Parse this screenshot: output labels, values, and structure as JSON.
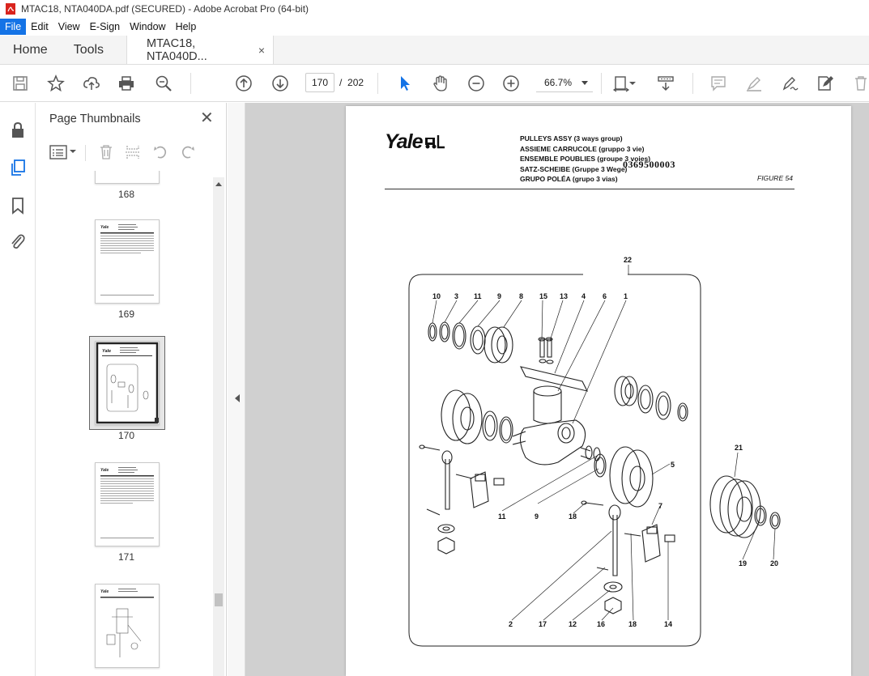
{
  "window": {
    "title": "MTAC18, NTA040DA.pdf (SECURED) - Adobe Acrobat Pro (64-bit)"
  },
  "menu": [
    "File",
    "Edit",
    "View",
    "E-Sign",
    "Window",
    "Help"
  ],
  "tabs": {
    "home": "Home",
    "tools": "Tools",
    "document": "MTAC18, NTA040D...",
    "close": "×"
  },
  "toolbar": {
    "current_page": "170",
    "page_sep": "/",
    "total_pages": "202",
    "zoom": "66.7%"
  },
  "thumbnails": {
    "title": "Page Thumbnails",
    "close": "✕",
    "pages": [
      "168",
      "169",
      "170",
      "171"
    ],
    "selected": "170"
  },
  "page": {
    "logo": "Yale",
    "header_lines": [
      "PULLEYS ASSY (3 ways group)",
      "ASSIEME CARRUCOLE (gruppo 3 vie)",
      "ENSEMBLE POUBLIES (groupe 3 voies)",
      "SATZ-SCHEIBE (Gruppe 3 Wege)",
      "GRUPO POLÉA (grupo 3 vias)"
    ],
    "part_number": "0369500003",
    "figure": "FIGURE 54",
    "callouts": [
      "22",
      "10",
      "3",
      "11",
      "9",
      "8",
      "15",
      "13",
      "4",
      "6",
      "1",
      "5",
      "21",
      "11",
      "9",
      "18",
      "7",
      "19",
      "20",
      "2",
      "17",
      "12",
      "16",
      "18",
      "14"
    ]
  }
}
